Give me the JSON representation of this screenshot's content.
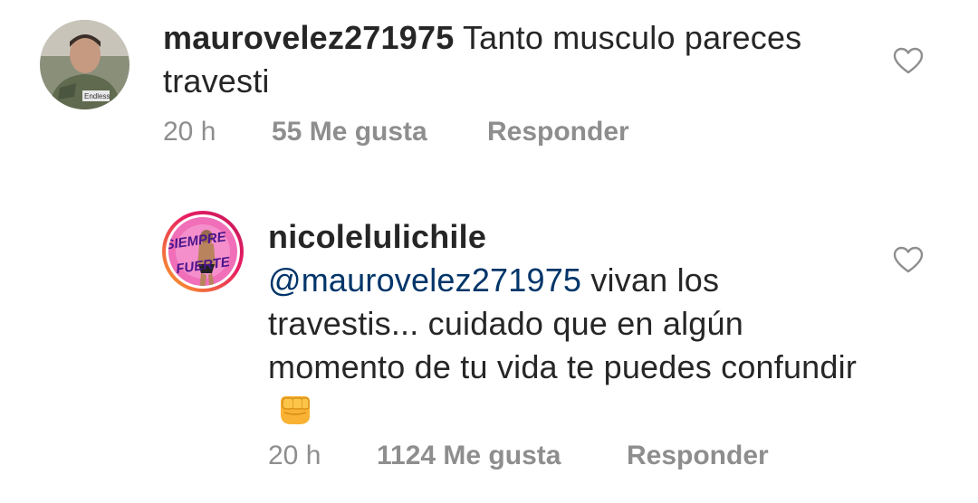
{
  "comments": [
    {
      "username": "maurovelez271975",
      "text": " Tanto musculo pareces travesti",
      "time": "20 h",
      "likes": "55 Me gusta",
      "reply": "Responder",
      "avatar_label": "Endless",
      "like_icon": "heart-outline-icon"
    },
    {
      "username": "nicolelulichile",
      "mention": "@maurovelez271975",
      "text": " vivan los travestis... cuidado que en algún momento de tu vida te puedes confundir",
      "emoji": "fist-emoji",
      "time": "20 h",
      "likes": "1124 Me gusta",
      "reply": "Responder",
      "avatar_label_1": "SIEMPRE",
      "avatar_label_2": "FUERTE",
      "like_icon": "heart-outline-icon"
    }
  ],
  "colors": {
    "text": "#262626",
    "meta": "#8e8e8e",
    "mention": "#003569",
    "story_ring_start": "#f9a825",
    "story_ring_end": "#e91e63"
  }
}
